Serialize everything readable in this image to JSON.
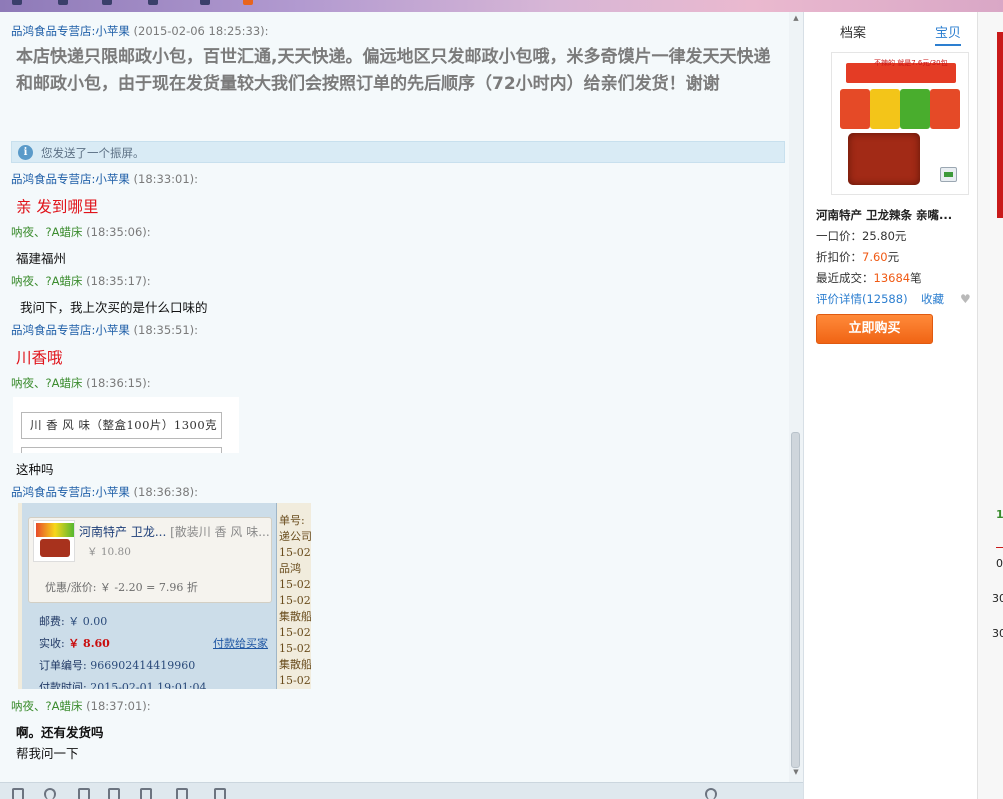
{
  "messages": {
    "m1": {
      "sender": "品鸿食品专营店:小苹果",
      "time": "(2015-02-06 18:25:33):",
      "text": "本店快递只限邮政小包，百世汇通,天天快递。偏远地区只发邮政小包哦，米多奇馍片一律发天天快递和邮政小包，由于现在发货量较大我们会按照订单的先后顺序（72小时内）给亲们发货！谢谢"
    },
    "system": "您发送了一个振屏。",
    "m2": {
      "sender": "品鸿食品专营店:小苹果",
      "time": "(18:33:01):",
      "text": "亲 发到哪里"
    },
    "m3": {
      "sender": "呐夜、?A蜡床",
      "time": "(18:35:06):",
      "text": "福建福州"
    },
    "m4": {
      "sender": "呐夜、?A蜡床",
      "time": "(18:35:17):",
      "text": "我问下，我上次买的是什么口味的"
    },
    "m5": {
      "sender": "品鸿食品专营店:小苹果",
      "time": "(18:35:51):",
      "text": "川香哦"
    },
    "m6": {
      "sender": "呐夜、?A蜡床",
      "time": "(18:36:15):",
      "image_text": "川 香 风 味（整盒100片）1300克",
      "text": "这种吗"
    },
    "m7": {
      "sender": "品鸿食品专营店:小苹果",
      "time": "(18:36:38):"
    },
    "m8": {
      "sender": "呐夜、?A蜡床",
      "time": "(18:37:01):",
      "line1": "啊。还有发货吗",
      "line2": "帮我问一下"
    }
  },
  "order_shot": {
    "product_name": "河南特产 卫龙...",
    "product_sku": "[散装川 香 风 味...",
    "price": "￥ 10.80",
    "discount": "优惠/涨价: ￥ -2.20 = 7.96 折",
    "shipping_label": "邮费:",
    "shipping_value": "￥ 0.00",
    "paid_label": "实收:",
    "paid_value": "￥ 8.60",
    "pay_link": "付款给买家",
    "order_no_label": "订单编号:",
    "order_no_value": "966902414419960",
    "pay_time_label": "付款时间:",
    "pay_time_value": "2015-02-01 19:01:04",
    "side_lines": [
      "单号:",
      "递公司",
      "15-02",
      "品鸿",
      "15-02",
      "15-02",
      "集散船",
      "15-02",
      "15-02",
      "集散船",
      "15-02"
    ]
  },
  "right_panel": {
    "tab_profile": "档案",
    "tab_item": "宝贝",
    "product_title": "河南特产 卫龙辣条 亲嘴...",
    "price_label": "一口价：",
    "price_value": "25.80元",
    "discount_label": "折扣价：",
    "discount_value": "7.60",
    "discount_unit": "元",
    "recent_label": "最近成交：",
    "recent_value": "13684",
    "recent_unit": "笔",
    "reviews_link": "评价详情(12588)",
    "favorite_link": "收藏",
    "buy_button": "立即购买",
    "package_text": "不辣的\n就是7.6元/30包"
  },
  "far_right": {
    "t1": "1",
    "t2": "0",
    "t3": "30",
    "t4": "30"
  }
}
